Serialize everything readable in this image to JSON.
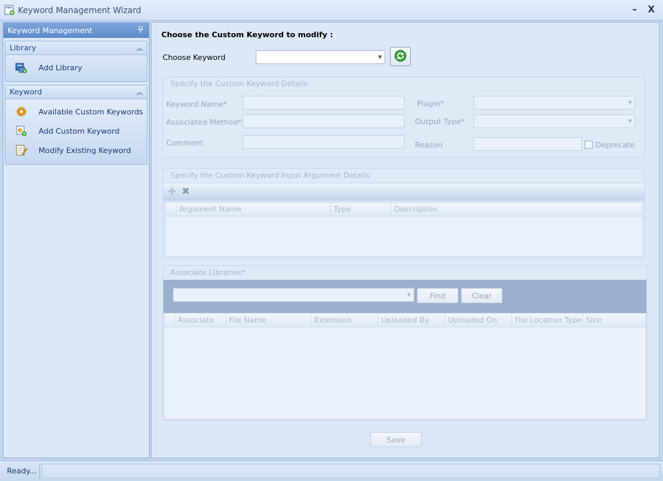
{
  "window": {
    "title": "Keyword Management Wizard",
    "minimize": "–",
    "close": "X"
  },
  "sidebar": {
    "header": "Keyword Management",
    "pin_icon": "pin-icon",
    "groups": [
      {
        "title": "Library",
        "items": [
          {
            "label": "Add Library",
            "icon": "add-library-icon"
          }
        ]
      },
      {
        "title": "Keyword",
        "items": [
          {
            "label": "Available Custom Keywords",
            "icon": "gear-icon"
          },
          {
            "label": "Add Custom Keyword",
            "icon": "add-keyword-icon"
          },
          {
            "label": "Modify Existing  Keyword",
            "icon": "edit-icon"
          }
        ]
      }
    ]
  },
  "main": {
    "heading": "Choose the Custom Keyword to modify  :",
    "choose_keyword_label": "Choose Keyword",
    "choose_keyword_value": "",
    "details": {
      "title": "Specify the Custom Keyword Details",
      "keyword_name_label": "Keyword Name*",
      "associated_method_label": "Associated Method*",
      "comment_label": "Comment",
      "plugin_label": "Plugin*",
      "output_type_label": "Output Type*",
      "reason_label": "Reason",
      "deprecate_label": "Deprecate"
    },
    "arguments": {
      "title": "Specify the Custom Keyword Input Argument Details",
      "add_symbol": "✚",
      "remove_symbol": "✖",
      "columns": [
        "Argument Name",
        "Type",
        "Description"
      ]
    },
    "libraries": {
      "title": "Associate Libraries*",
      "find_label": "Find",
      "clear_label": "Clear",
      "columns": [
        "Associate",
        "File Name",
        "Extension",
        "Uploaded By",
        "Uploaded On",
        "File Location Type",
        "Size"
      ]
    },
    "save_label": "Save"
  },
  "status": {
    "text": "Ready..."
  }
}
